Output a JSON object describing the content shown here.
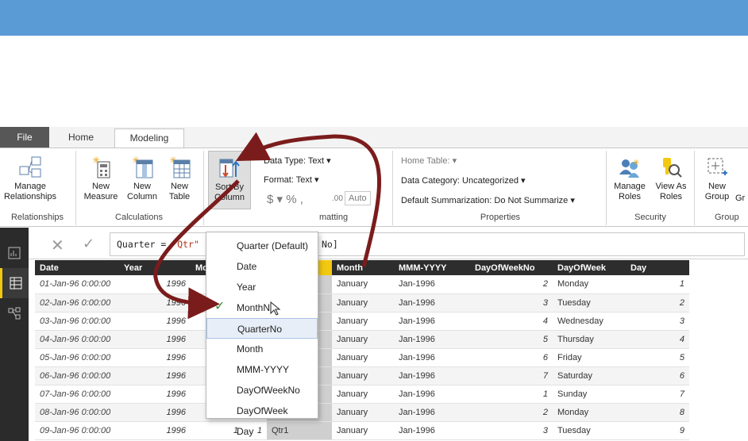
{
  "tabs": {
    "file": "File",
    "home": "Home",
    "modeling": "Modeling"
  },
  "ribbon": {
    "manage_relationships": "Manage\nRelationships",
    "new_measure": "New\nMeasure",
    "new_column": "New\nColumn",
    "new_table": "New\nTable",
    "sort_by_column": "Sort By\nColumn",
    "data_type": "Data Type: Text ▾",
    "format": "Format: Text ▾",
    "format_symbols": "$ ▾ % ,",
    "decimal_icon": ".00",
    "auto": "Auto",
    "home_table": "Home Table: ▾",
    "data_category": "Data Category: Uncategorized ▾",
    "default_summarization": "Default Summarization: Do Not Summarize ▾",
    "manage_roles": "Manage\nRoles",
    "view_as_roles": "View As\nRoles",
    "new_group": "New\nGroup",
    "edit_groups": "Gr",
    "groups": {
      "relationships": "Relationships",
      "calculations": "Calculations",
      "formatting": "matting",
      "properties": "Properties",
      "security": "Security",
      "groups": "Group"
    }
  },
  "formula": {
    "prefix": "Quarter = ",
    "string": "\"Qtr\"",
    "suffix": "No]"
  },
  "dropdown": {
    "items": [
      "Quarter (Default)",
      "Date",
      "Year",
      "MonthNo",
      "QuarterNo",
      "Month",
      "MMM-YYYY",
      "DayOfWeekNo",
      "DayOfWeek",
      "Day"
    ],
    "checked_index": 4
  },
  "table": {
    "headers": [
      "Date",
      "Year",
      "Mo",
      "",
      "Quarter",
      "Month",
      "MMM-YYYY",
      "DayOfWeekNo",
      "DayOfWeek",
      "Day"
    ],
    "rows": [
      [
        "01-Jan-96 0:00:00",
        "1996",
        "",
        "",
        "Qtr1",
        "January",
        "Jan-1996",
        "2",
        "Monday",
        "1"
      ],
      [
        "02-Jan-96 0:00:00",
        "1996",
        "",
        "",
        "Qtr1",
        "January",
        "Jan-1996",
        "3",
        "Tuesday",
        "2"
      ],
      [
        "03-Jan-96 0:00:00",
        "1996",
        "",
        "",
        "Qtr1",
        "January",
        "Jan-1996",
        "4",
        "Wednesday",
        "3"
      ],
      [
        "04-Jan-96 0:00:00",
        "1996",
        "",
        "",
        "Qtr1",
        "January",
        "Jan-1996",
        "5",
        "Thursday",
        "4"
      ],
      [
        "05-Jan-96 0:00:00",
        "1996",
        "",
        "",
        "Qtr1",
        "January",
        "Jan-1996",
        "6",
        "Friday",
        "5"
      ],
      [
        "06-Jan-96 0:00:00",
        "1996",
        "",
        "",
        "Qtr1",
        "January",
        "Jan-1996",
        "7",
        "Saturday",
        "6"
      ],
      [
        "07-Jan-96 0:00:00",
        "1996",
        "",
        "",
        "Qtr1",
        "January",
        "Jan-1996",
        "1",
        "Sunday",
        "7"
      ],
      [
        "08-Jan-96 0:00:00",
        "1996",
        "",
        "",
        "Qtr1",
        "January",
        "Jan-1996",
        "2",
        "Monday",
        "8"
      ],
      [
        "09-Jan-96 0:00:00",
        "1996",
        "1",
        "1",
        "Qtr1",
        "January",
        "Jan-1996",
        "3",
        "Tuesday",
        "9"
      ]
    ]
  },
  "colors": {
    "banner": "#5b9bd5",
    "arrow": "#7b1c1c",
    "selected_header": "#f2c811"
  }
}
